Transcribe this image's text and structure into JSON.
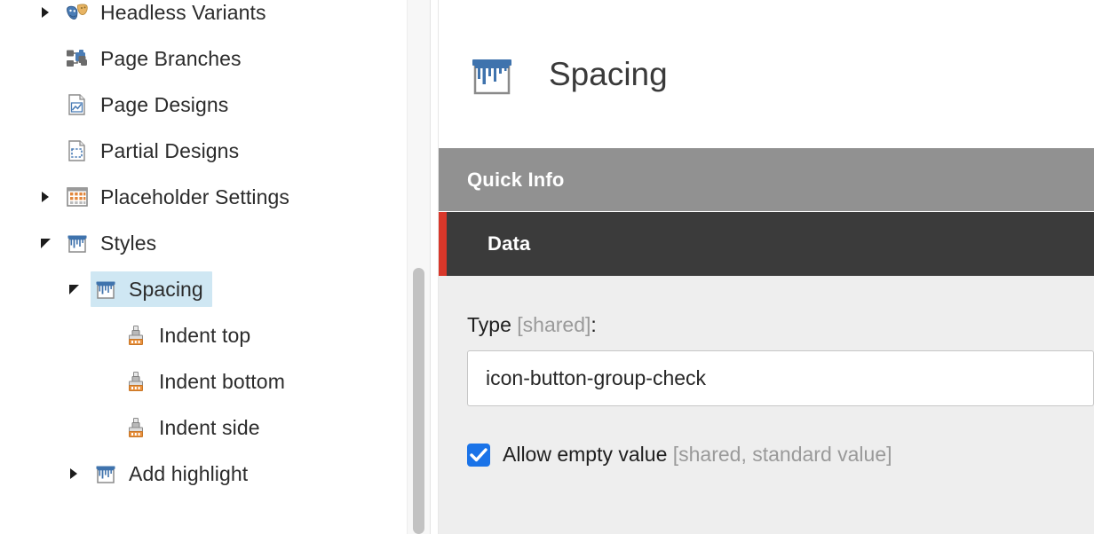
{
  "tree": {
    "clipped_top_label": "",
    "items": [
      {
        "label": "Headless Variants",
        "icon": "masks-icon",
        "twisty": "collapsed",
        "depth": 1,
        "selected": false
      },
      {
        "label": "Page Branches",
        "icon": "page-branches-icon",
        "twisty": "none",
        "depth": 1,
        "selected": false
      },
      {
        "label": "Page Designs",
        "icon": "page-designs-icon",
        "twisty": "none",
        "depth": 1,
        "selected": false
      },
      {
        "label": "Partial Designs",
        "icon": "partial-designs-icon",
        "twisty": "none",
        "depth": 1,
        "selected": false
      },
      {
        "label": "Placeholder Settings",
        "icon": "placeholder-settings-icon",
        "twisty": "collapsed",
        "depth": 1,
        "selected": false
      },
      {
        "label": "Styles",
        "icon": "paint-bucket-icon",
        "twisty": "expanded",
        "depth": 1,
        "selected": false
      },
      {
        "label": "Spacing",
        "icon": "paint-bucket-icon",
        "twisty": "expanded",
        "depth": 2,
        "selected": true
      },
      {
        "label": "Indent top",
        "icon": "paintbrush-icon",
        "twisty": "none",
        "depth": 3,
        "selected": false
      },
      {
        "label": "Indent bottom",
        "icon": "paintbrush-icon",
        "twisty": "none",
        "depth": 3,
        "selected": false
      },
      {
        "label": "Indent side",
        "icon": "paintbrush-icon",
        "twisty": "none",
        "depth": 3,
        "selected": false
      },
      {
        "label": "Add highlight",
        "icon": "paint-bucket-icon",
        "twisty": "collapsed",
        "depth": 2,
        "selected": false
      }
    ]
  },
  "detail": {
    "title": "Spacing",
    "title_icon": "paint-bucket-icon",
    "bands": {
      "quick_info": "Quick Info",
      "data": "Data",
      "data_accent_color": "#d8372a",
      "quick_info_bg": "#919191",
      "data_bg": "#3b3b3b"
    },
    "fields": {
      "type_label": "Type",
      "type_label_suffix": "[shared]",
      "type_label_colon": ":",
      "type_value": "icon-button-group-check",
      "type_placeholder": "",
      "allow_empty_checked": true,
      "allow_empty_label": "Allow empty value",
      "allow_empty_suffix": "[shared, standard value]"
    }
  },
  "colors": {
    "selection": "#cfe7f3",
    "accent_blue": "#1a73e8",
    "panel_bg": "#eeeeee"
  }
}
